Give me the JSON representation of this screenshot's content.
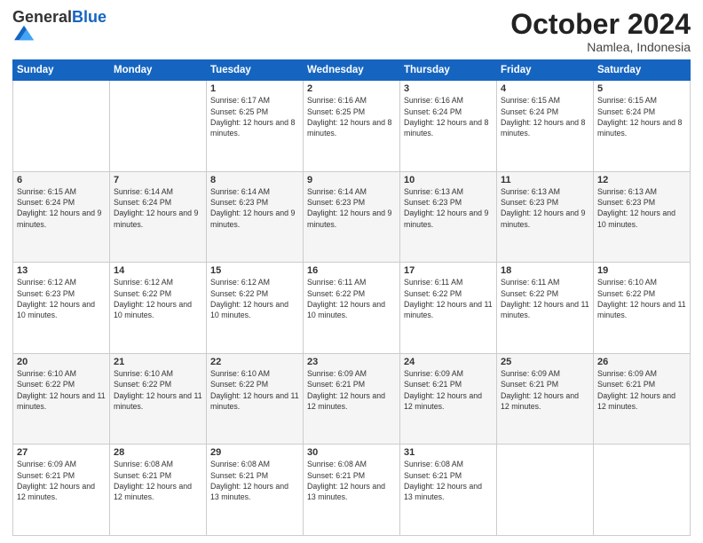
{
  "logo": {
    "general": "General",
    "blue": "Blue"
  },
  "header": {
    "month": "October 2024",
    "location": "Namlea, Indonesia"
  },
  "days": [
    "Sunday",
    "Monday",
    "Tuesday",
    "Wednesday",
    "Thursday",
    "Friday",
    "Saturday"
  ],
  "weeks": [
    [
      {
        "day": "",
        "sunrise": "",
        "sunset": "",
        "daylight": ""
      },
      {
        "day": "",
        "sunrise": "",
        "sunset": "",
        "daylight": ""
      },
      {
        "day": "1",
        "sunrise": "Sunrise: 6:17 AM",
        "sunset": "Sunset: 6:25 PM",
        "daylight": "Daylight: 12 hours and 8 minutes."
      },
      {
        "day": "2",
        "sunrise": "Sunrise: 6:16 AM",
        "sunset": "Sunset: 6:25 PM",
        "daylight": "Daylight: 12 hours and 8 minutes."
      },
      {
        "day": "3",
        "sunrise": "Sunrise: 6:16 AM",
        "sunset": "Sunset: 6:24 PM",
        "daylight": "Daylight: 12 hours and 8 minutes."
      },
      {
        "day": "4",
        "sunrise": "Sunrise: 6:15 AM",
        "sunset": "Sunset: 6:24 PM",
        "daylight": "Daylight: 12 hours and 8 minutes."
      },
      {
        "day": "5",
        "sunrise": "Sunrise: 6:15 AM",
        "sunset": "Sunset: 6:24 PM",
        "daylight": "Daylight: 12 hours and 8 minutes."
      }
    ],
    [
      {
        "day": "6",
        "sunrise": "Sunrise: 6:15 AM",
        "sunset": "Sunset: 6:24 PM",
        "daylight": "Daylight: 12 hours and 9 minutes."
      },
      {
        "day": "7",
        "sunrise": "Sunrise: 6:14 AM",
        "sunset": "Sunset: 6:24 PM",
        "daylight": "Daylight: 12 hours and 9 minutes."
      },
      {
        "day": "8",
        "sunrise": "Sunrise: 6:14 AM",
        "sunset": "Sunset: 6:23 PM",
        "daylight": "Daylight: 12 hours and 9 minutes."
      },
      {
        "day": "9",
        "sunrise": "Sunrise: 6:14 AM",
        "sunset": "Sunset: 6:23 PM",
        "daylight": "Daylight: 12 hours and 9 minutes."
      },
      {
        "day": "10",
        "sunrise": "Sunrise: 6:13 AM",
        "sunset": "Sunset: 6:23 PM",
        "daylight": "Daylight: 12 hours and 9 minutes."
      },
      {
        "day": "11",
        "sunrise": "Sunrise: 6:13 AM",
        "sunset": "Sunset: 6:23 PM",
        "daylight": "Daylight: 12 hours and 9 minutes."
      },
      {
        "day": "12",
        "sunrise": "Sunrise: 6:13 AM",
        "sunset": "Sunset: 6:23 PM",
        "daylight": "Daylight: 12 hours and 10 minutes."
      }
    ],
    [
      {
        "day": "13",
        "sunrise": "Sunrise: 6:12 AM",
        "sunset": "Sunset: 6:23 PM",
        "daylight": "Daylight: 12 hours and 10 minutes."
      },
      {
        "day": "14",
        "sunrise": "Sunrise: 6:12 AM",
        "sunset": "Sunset: 6:22 PM",
        "daylight": "Daylight: 12 hours and 10 minutes."
      },
      {
        "day": "15",
        "sunrise": "Sunrise: 6:12 AM",
        "sunset": "Sunset: 6:22 PM",
        "daylight": "Daylight: 12 hours and 10 minutes."
      },
      {
        "day": "16",
        "sunrise": "Sunrise: 6:11 AM",
        "sunset": "Sunset: 6:22 PM",
        "daylight": "Daylight: 12 hours and 10 minutes."
      },
      {
        "day": "17",
        "sunrise": "Sunrise: 6:11 AM",
        "sunset": "Sunset: 6:22 PM",
        "daylight": "Daylight: 12 hours and 11 minutes."
      },
      {
        "day": "18",
        "sunrise": "Sunrise: 6:11 AM",
        "sunset": "Sunset: 6:22 PM",
        "daylight": "Daylight: 12 hours and 11 minutes."
      },
      {
        "day": "19",
        "sunrise": "Sunrise: 6:10 AM",
        "sunset": "Sunset: 6:22 PM",
        "daylight": "Daylight: 12 hours and 11 minutes."
      }
    ],
    [
      {
        "day": "20",
        "sunrise": "Sunrise: 6:10 AM",
        "sunset": "Sunset: 6:22 PM",
        "daylight": "Daylight: 12 hours and 11 minutes."
      },
      {
        "day": "21",
        "sunrise": "Sunrise: 6:10 AM",
        "sunset": "Sunset: 6:22 PM",
        "daylight": "Daylight: 12 hours and 11 minutes."
      },
      {
        "day": "22",
        "sunrise": "Sunrise: 6:10 AM",
        "sunset": "Sunset: 6:22 PM",
        "daylight": "Daylight: 12 hours and 11 minutes."
      },
      {
        "day": "23",
        "sunrise": "Sunrise: 6:09 AM",
        "sunset": "Sunset: 6:21 PM",
        "daylight": "Daylight: 12 hours and 12 minutes."
      },
      {
        "day": "24",
        "sunrise": "Sunrise: 6:09 AM",
        "sunset": "Sunset: 6:21 PM",
        "daylight": "Daylight: 12 hours and 12 minutes."
      },
      {
        "day": "25",
        "sunrise": "Sunrise: 6:09 AM",
        "sunset": "Sunset: 6:21 PM",
        "daylight": "Daylight: 12 hours and 12 minutes."
      },
      {
        "day": "26",
        "sunrise": "Sunrise: 6:09 AM",
        "sunset": "Sunset: 6:21 PM",
        "daylight": "Daylight: 12 hours and 12 minutes."
      }
    ],
    [
      {
        "day": "27",
        "sunrise": "Sunrise: 6:09 AM",
        "sunset": "Sunset: 6:21 PM",
        "daylight": "Daylight: 12 hours and 12 minutes."
      },
      {
        "day": "28",
        "sunrise": "Sunrise: 6:08 AM",
        "sunset": "Sunset: 6:21 PM",
        "daylight": "Daylight: 12 hours and 12 minutes."
      },
      {
        "day": "29",
        "sunrise": "Sunrise: 6:08 AM",
        "sunset": "Sunset: 6:21 PM",
        "daylight": "Daylight: 12 hours and 13 minutes."
      },
      {
        "day": "30",
        "sunrise": "Sunrise: 6:08 AM",
        "sunset": "Sunset: 6:21 PM",
        "daylight": "Daylight: 12 hours and 13 minutes."
      },
      {
        "day": "31",
        "sunrise": "Sunrise: 6:08 AM",
        "sunset": "Sunset: 6:21 PM",
        "daylight": "Daylight: 12 hours and 13 minutes."
      },
      {
        "day": "",
        "sunrise": "",
        "sunset": "",
        "daylight": ""
      },
      {
        "day": "",
        "sunrise": "",
        "sunset": "",
        "daylight": ""
      }
    ]
  ]
}
